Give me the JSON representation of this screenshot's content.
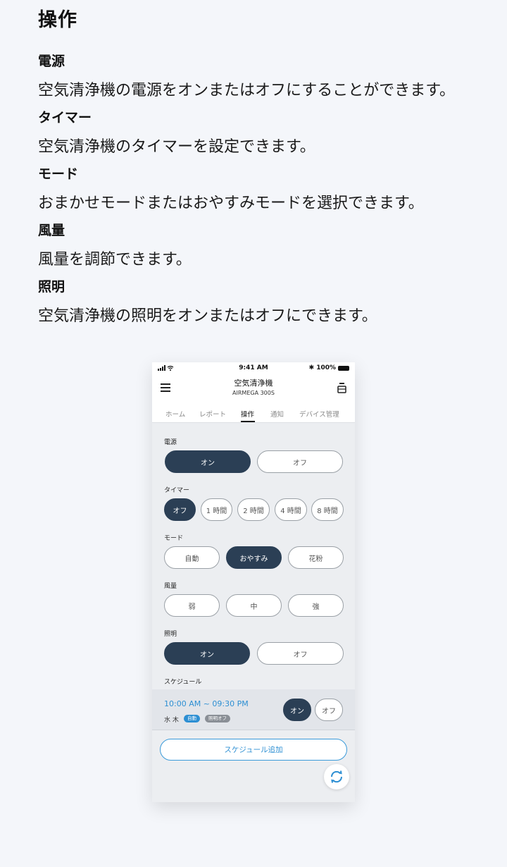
{
  "doc": {
    "title": "操作",
    "sections": [
      {
        "heading": "電源",
        "text": "空気清浄機の電源をオンまたはオフにすることができます。"
      },
      {
        "heading": "タイマー",
        "text": "空気清浄機のタイマーを設定できます。"
      },
      {
        "heading": "モード",
        "text": "おまかせモードまたはおやすみモードを選択できます。"
      },
      {
        "heading": "風量",
        "text": "風量を調節できます。"
      },
      {
        "heading": "照明",
        "text": "空気清浄機の照明をオンまたはオフにできます。"
      }
    ]
  },
  "phone": {
    "status": {
      "time": "9:41 AM",
      "battery": "100%"
    },
    "appbar": {
      "title": "空気清浄機",
      "subtitle": "AIRMEGA 300S"
    },
    "tabs": [
      "ホーム",
      "レポート",
      "操作",
      "通知",
      "デバイス管理"
    ],
    "active_tab": "操作",
    "power": {
      "label": "電源",
      "options": [
        "オン",
        "オフ"
      ],
      "selected": "オン"
    },
    "timer": {
      "label": "タイマー",
      "options": [
        "オフ",
        "1 時間",
        "2 時間",
        "4 時間",
        "8 時間"
      ],
      "selected": "オフ"
    },
    "mode": {
      "label": "モード",
      "options": [
        "自動",
        "おやすみ",
        "花粉"
      ],
      "selected": "おやすみ"
    },
    "fan": {
      "label": "風量",
      "options": [
        "弱",
        "中",
        "強"
      ],
      "selected": null
    },
    "light": {
      "label": "照明",
      "options": [
        "オン",
        "オフ"
      ],
      "selected": "オン"
    },
    "schedule": {
      "label": "スケジュール",
      "time": "10:00 AM ~ 09:30 PM",
      "days": "水 木",
      "badges": [
        "自動",
        "照明オフ"
      ],
      "toggle": [
        "オン",
        "オフ"
      ],
      "toggle_selected": "オン"
    },
    "add_button": "スケジュール追加",
    "colors": {
      "accent": "#2d8fd3",
      "selected": "#2b3f55"
    }
  }
}
